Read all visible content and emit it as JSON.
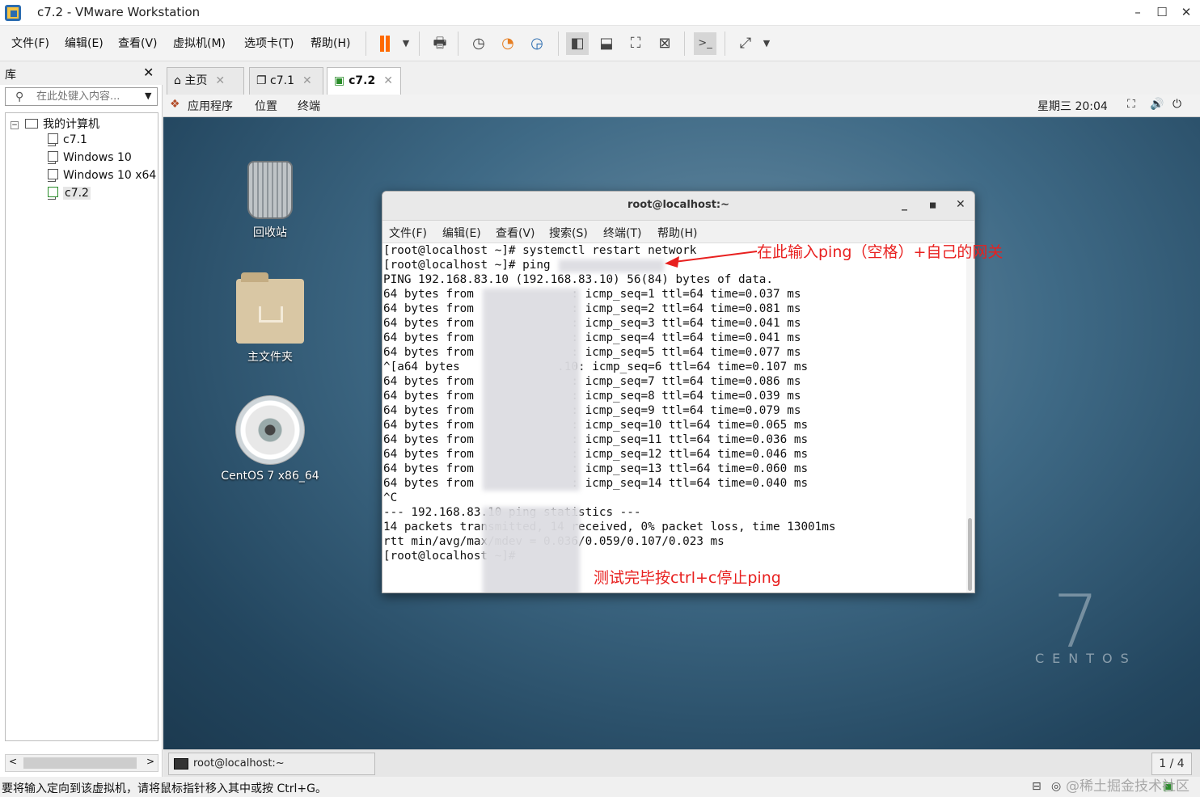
{
  "window": {
    "title": "c7.2 - VMware Workstation",
    "min": "–",
    "max": "☐",
    "close": "✕"
  },
  "menu": [
    "文件(F)",
    "编辑(E)",
    "查看(V)",
    "虚拟机(M)",
    "选项卡(T)",
    "帮助(H)"
  ],
  "library": {
    "title": "库",
    "close": "✕",
    "search_placeholder": "在此处键入内容...",
    "root": "我的计算机",
    "items": [
      "c7.1",
      "Windows 10",
      "Windows 10 x64",
      "c7.2"
    ],
    "selected": "c7.2"
  },
  "tabs": [
    {
      "label": "主页"
    },
    {
      "label": "c7.1"
    },
    {
      "label": "c7.2",
      "active": true
    }
  ],
  "gnome": {
    "apps": "应用程序",
    "places": "位置",
    "terminal": "终端",
    "clock": "星期三 20:04"
  },
  "desktop": {
    "trash": "回收站",
    "home": "主文件夹",
    "disc": "CentOS 7 x86_64",
    "brand_num": "7",
    "brand_text": "CENTOS"
  },
  "terminal": {
    "title": "root@localhost:~",
    "menu": [
      "文件(F)",
      "编辑(E)",
      "查看(V)",
      "搜索(S)",
      "终端(T)",
      "帮助(H)"
    ],
    "lines": [
      "[root@localhost ~]# systemctl restart network",
      "[root@localhost ~]# ping ",
      "PING 192.168.83.10 (192.168.83.10) 56(84) bytes of data.",
      "64 bytes from              : icmp_seq=1 ttl=64 time=0.037 ms",
      "64 bytes from              : icmp_seq=2 ttl=64 time=0.081 ms",
      "64 bytes from              : icmp_seq=3 ttl=64 time=0.041 ms",
      "64 bytes from              : icmp_seq=4 ttl=64 time=0.041 ms",
      "64 bytes from              : icmp_seq=5 ttl=64 time=0.077 ms",
      "^[a64 bytes              .10: icmp_seq=6 ttl=64 time=0.107 ms",
      "64 bytes from              : icmp_seq=7 ttl=64 time=0.086 ms",
      "64 bytes from              : icmp_seq=8 ttl=64 time=0.039 ms",
      "64 bytes from              : icmp_seq=9 ttl=64 time=0.079 ms",
      "64 bytes from              : icmp_seq=10 ttl=64 time=0.065 ms",
      "64 bytes from              : icmp_seq=11 ttl=64 time=0.036 ms",
      "64 bytes from              : icmp_seq=12 ttl=64 time=0.046 ms",
      "64 bytes from              : icmp_seq=13 ttl=64 time=0.060 ms",
      "64 bytes from              : icmp_seq=14 ttl=64 time=0.040 ms",
      "^C",
      "--- 192.168.83.10 ping statistics ---",
      "14 packets transmitted, 14 received, 0% packet loss, time 13001ms",
      "rtt min/avg/max/mdev = 0.036/0.059/0.107/0.023 ms",
      "[root@localhost ~]# "
    ],
    "annotation_top": "在此输入ping（空格）+自己的网关",
    "annotation_bottom": "测试完毕按ctrl+c停止ping"
  },
  "taskbar": {
    "item": "root@localhost:~",
    "pager": "1 / 4"
  },
  "status": {
    "text": "要将输入定向到该虚拟机，请将鼠标指针移入其中或按 Ctrl+G。",
    "watermark": "@稀土掘金技术社区"
  },
  "colors": {
    "accent": "#ff6a00",
    "annotation": "#e8201f",
    "desktop": "#3f6a86"
  }
}
